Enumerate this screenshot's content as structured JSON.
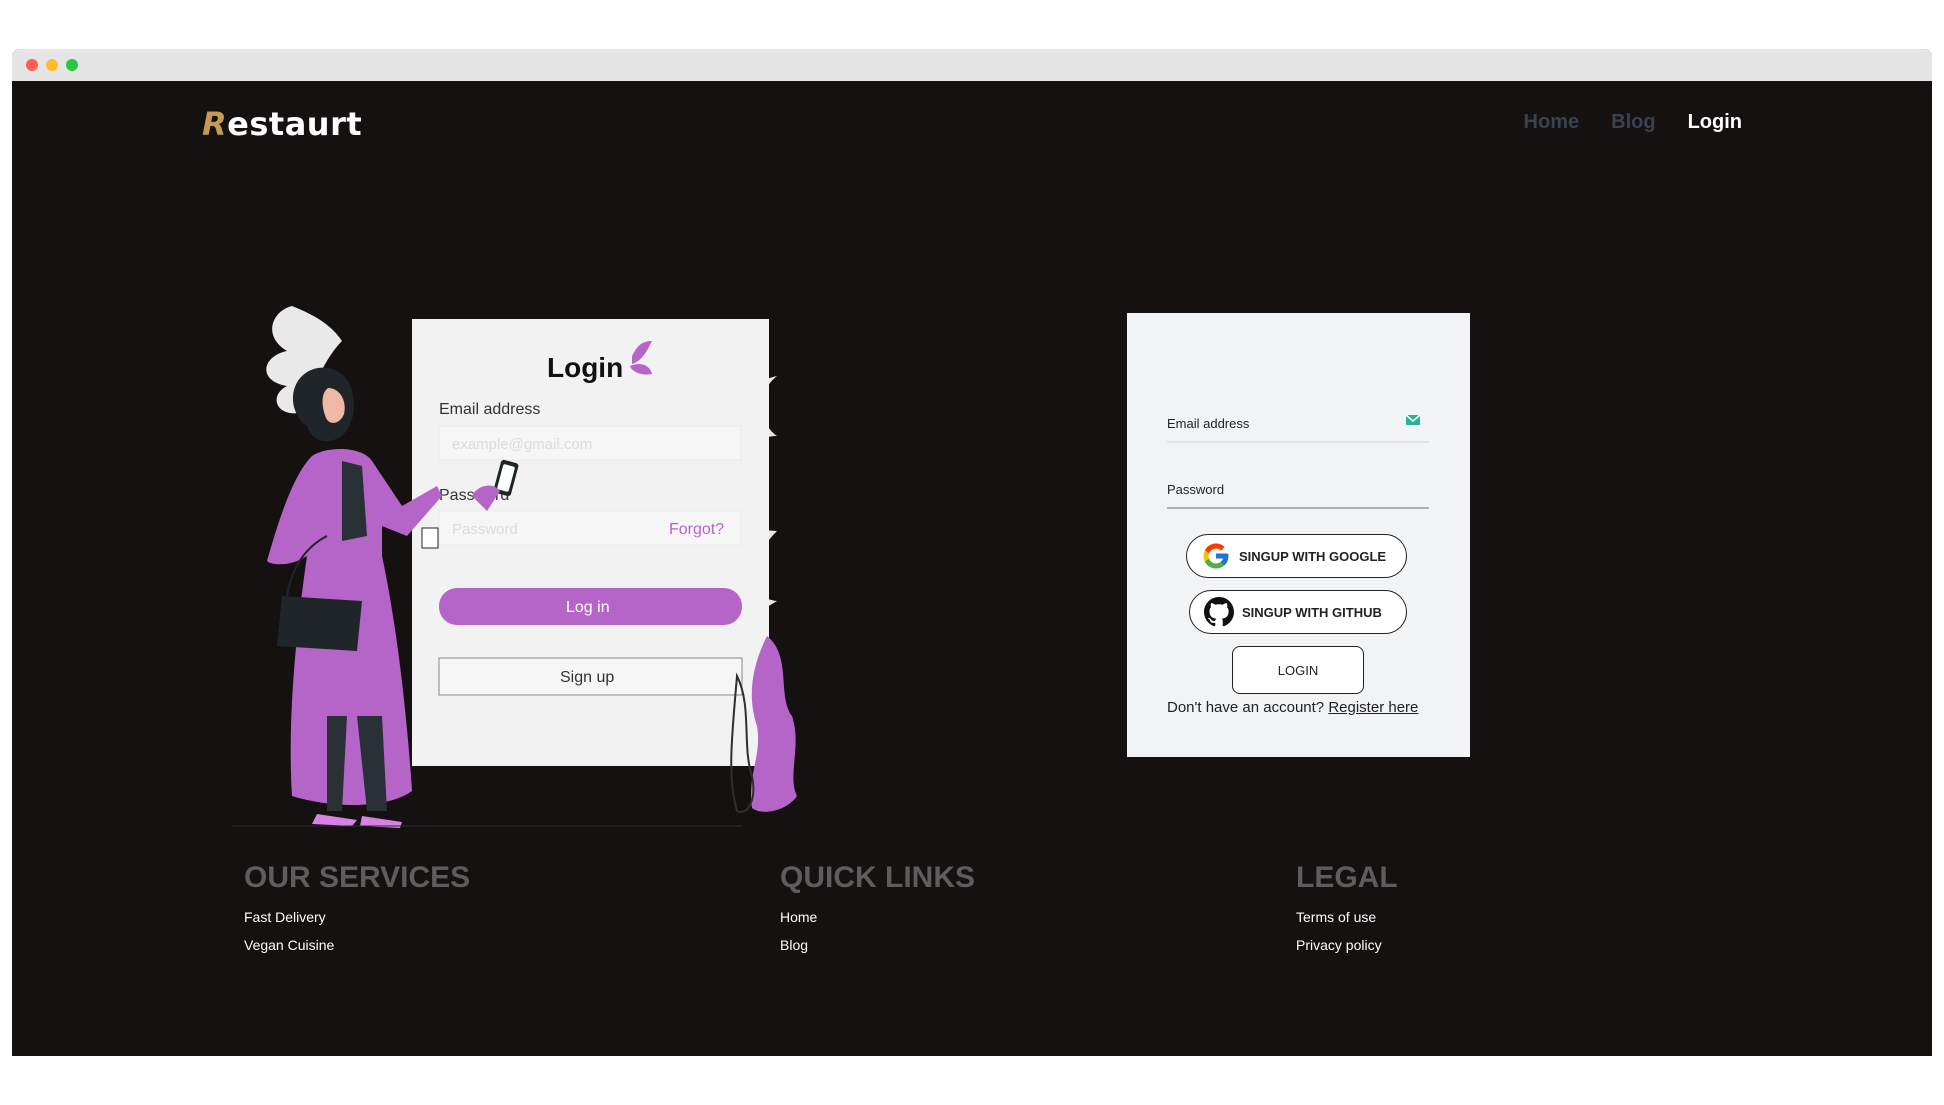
{
  "brand": {
    "name": "estaurt",
    "initial": "R",
    "accent": "#c59a55"
  },
  "nav": {
    "items": [
      {
        "label": "Home",
        "active": false
      },
      {
        "label": "Blog",
        "active": false
      },
      {
        "label": "Login",
        "active": true
      }
    ]
  },
  "illustration": {
    "title": "Login",
    "email_label": "Email address",
    "email_placeholder": "example@gmail.com",
    "password_label": "Password",
    "password_placeholder": "Password",
    "forgot_label": "Forgot?",
    "login_button": "Log in",
    "signup_button": "Sign up",
    "accent": "#b565c8"
  },
  "login_card": {
    "email_label": "Email address",
    "password_label": "Password",
    "google_button": "SINGUP WITH GOOGLE",
    "github_button": "SINGUP WITH GITHUB",
    "login_button": "LOGIN",
    "register_prompt": "Don't have an account?",
    "register_link": "Register here"
  },
  "footer": {
    "services": {
      "title": "OUR SERVICES",
      "links": [
        "Fast Delivery",
        "Vegan Cuisine"
      ]
    },
    "quick_links": {
      "title": "QUICK LINKS",
      "links": [
        "Home",
        "Blog"
      ]
    },
    "legal": {
      "title": "LEGAL",
      "links": [
        "Terms of use",
        "Privacy policy"
      ]
    }
  }
}
